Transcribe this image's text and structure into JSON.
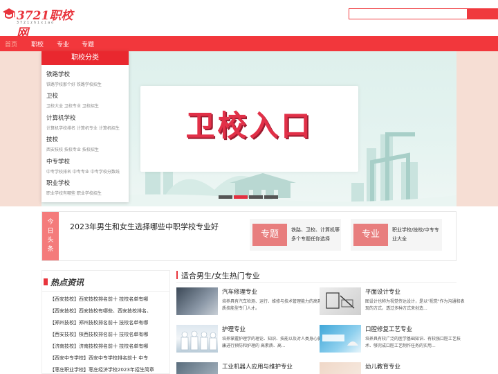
{
  "header": {
    "logo_text": "3721职校网",
    "logo_subtext": "3721zhixiao",
    "search_placeholder": ""
  },
  "nav": {
    "items": [
      "首页",
      "职校",
      "专业",
      "专题"
    ]
  },
  "banner": {
    "title": "卫校入口",
    "slides": 5,
    "active_slide": 2
  },
  "side_menu": {
    "title": "职校分类",
    "items": [
      {
        "title": "铁路学校",
        "sub": "铁路学校那个好 铁路学校招生"
      },
      {
        "title": "卫校",
        "sub": "卫校大全 卫校专业 卫校招生"
      },
      {
        "title": "计算机学校",
        "sub": "计算机学校排名 计算机专业 计算机招生"
      },
      {
        "title": "技校",
        "sub": "西安技校 技校专业 技校招生"
      },
      {
        "title": "中专学校",
        "sub": "中专学校排名 中专专业 中专学校分数线"
      },
      {
        "title": "职业学校",
        "sub": "职业学校有哪些 职业学校招生"
      }
    ]
  },
  "headline": {
    "tag": [
      "今",
      "日",
      "头",
      "条"
    ],
    "text": "2023年男生和女生选择哪些中职学校专业好",
    "topics": [
      {
        "label": "专题",
        "desc": "铁路、卫校、计算机等多个专题任你选择"
      },
      {
        "label": "专业",
        "desc": "职业学校/技校/中专专业大全"
      }
    ]
  },
  "hot_news": {
    "title": "热点资讯",
    "items": [
      "【西安技校】西安技校排名前十 技校名单有哪",
      "【西安技校】西安技校有哪些、西安技校排名、",
      "【郑州技校】郑州技校排名前十 技校名单有哪",
      "【西安技校】陕西技校排名前十 技校名单有哪",
      "【济南技校】济南技校排名前十 技校名单有哪",
      "【西安中专学校】西安中专学校排名前十 中专",
      "【枣庄职业学校】枣庄经济学校2023年招生简章"
    ]
  },
  "majors": {
    "title": "适合男生/女生热门专业",
    "items": [
      {
        "name": "汽车修理专业",
        "desc": "培养具有汽车检测、运行、维修与技术管理能力的高素质技能型专门人才。"
      },
      {
        "name": "平面设计专业",
        "desc": "图设计也称为视觉传达设计，是以\"视觉\"作为沟通和表现的方式，透过多种方式来创造..."
      },
      {
        "name": "护理专业",
        "desc": "培养掌握护理学的理论、知识、技能以及对人类身心健康进行预防和护理的 高素质、高..."
      },
      {
        "name": "口腔修复工艺专业",
        "desc": "培养具有较广泛的医学基础知识、有较强口腔工艺技术、够完成口腔工艺制作任务的实用..."
      },
      {
        "name": "工业机器人应用与维护专业",
        "desc": ""
      },
      {
        "name": "幼儿教育专业",
        "desc": ""
      }
    ]
  },
  "colors": {
    "brand_red": "#f2373c",
    "menu_red": "#e9282f",
    "tag_pink": "#f47b7b"
  }
}
